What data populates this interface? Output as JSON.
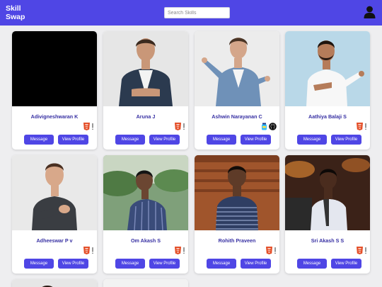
{
  "app": {
    "logo_line1": "Skill",
    "logo_line2": "Swap"
  },
  "search": {
    "placeholder": "Search Skills",
    "value": ""
  },
  "header": {
    "profile_icon": "user-avatar-icon",
    "accent_color": "#4f46e5"
  },
  "cards": [
    {
      "name": "Adivigneshwaran K",
      "skills": [
        "html5-icon",
        "warning-icon"
      ],
      "message_label": "Message",
      "view_label": "View Profile"
    },
    {
      "name": "Aruna J",
      "skills": [
        "html5-icon",
        "warning-icon"
      ],
      "message_label": "Message",
      "view_label": "View Profile"
    },
    {
      "name": "Ashwin Narayanan C",
      "skills": [
        "bottle-icon",
        "github-icon"
      ],
      "message_label": "Message",
      "view_label": "View Profile"
    },
    {
      "name": "Aathiya Balaji S",
      "skills": [
        "html5-icon",
        "warning-icon"
      ],
      "message_label": "Message",
      "view_label": "View Profile"
    },
    {
      "name": "Adheeswar P v",
      "skills": [
        "html5-icon",
        "warning-icon"
      ],
      "message_label": "Message",
      "view_label": "View Profile"
    },
    {
      "name": "Om Akash S",
      "skills": [
        "html5-icon",
        "warning-icon"
      ],
      "message_label": "Message",
      "view_label": "View Profile"
    },
    {
      "name": "Rohith Praveen",
      "skills": [
        "html5-icon",
        "warning-icon"
      ],
      "message_label": "Message",
      "view_label": "View Profile"
    },
    {
      "name": "Sri Akash S S",
      "skills": [
        "html5-icon",
        "warning-icon"
      ],
      "message_label": "Message",
      "view_label": "View Profile"
    }
  ]
}
